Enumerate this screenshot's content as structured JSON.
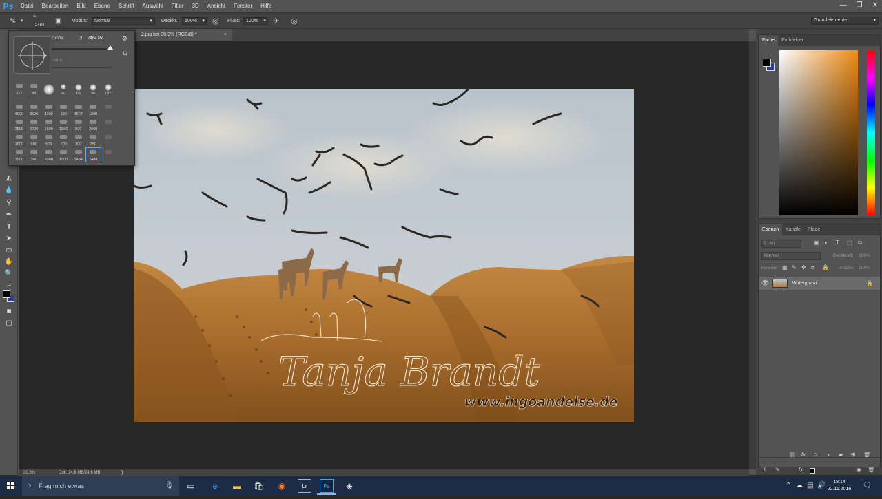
{
  "app": {
    "logo": "Ps",
    "menu": [
      "Datei",
      "Bearbeiten",
      "Bild",
      "Ebene",
      "Schrift",
      "Auswahl",
      "Filter",
      "3D",
      "Ansicht",
      "Fenster",
      "Hilfe"
    ]
  },
  "options_bar": {
    "brush_size_small": "2484",
    "modus_label": "Modus:",
    "modus_value": "Normal",
    "deckkraft_label": "Deckkr.:",
    "deckkraft_value": "100%",
    "fluss_label": "Fluss:",
    "fluss_value": "100%",
    "workspace": "Grundelemente"
  },
  "brush_popup": {
    "size_label": "Größe:",
    "size_value": "2484 Px",
    "size_fraction": 1.0,
    "hardness_label": "Härte:",
    "rows": [
      [
        "322",
        "88",
        "",
        "40",
        "66",
        "56",
        "187"
      ],
      [
        "4000",
        "3500",
        "1100",
        "680",
        "1667",
        "1500",
        ""
      ],
      [
        "2500",
        "2000",
        "1600",
        "1500",
        "800",
        "2000",
        ""
      ],
      [
        "1500",
        "500",
        "500",
        "500",
        "300",
        "250",
        ""
      ],
      [
        "1500",
        "300",
        "2000",
        "1000",
        "2484",
        "2484",
        ""
      ]
    ]
  },
  "document": {
    "tab_title": "2.jpg bei 30,3% (RGB/8) *",
    "zoom": "30,3%",
    "doc_info": "Dok: 24,6 MB/24,6 MB",
    "watermark_name": "Tanja Brandt",
    "watermark_url": "www.ingoandelse.de"
  },
  "color_panel": {
    "tabs": [
      "Farbe",
      "Farbfelder"
    ],
    "fg_color": "#000000",
    "bg_color": "#2b3f98"
  },
  "layers_panel": {
    "tabs": [
      "Ebenen",
      "Kanäle",
      "Pfade"
    ],
    "search_placeholder": "Art",
    "blend_mode": "Normal",
    "opacity_label": "Deckkraft:",
    "opacity_value": "100%",
    "lock_label": "Fixieren:",
    "fill_label": "Fläche:",
    "fill_value": "100%",
    "layer_name": "Hintergrund"
  },
  "taskbar": {
    "search_placeholder": "Frag mich etwas",
    "time": "18:14",
    "date": "22.11.2016"
  }
}
